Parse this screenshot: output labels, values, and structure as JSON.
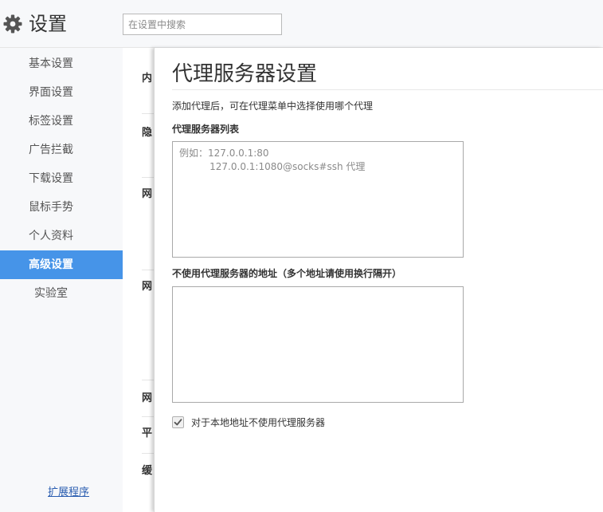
{
  "header": {
    "title": "设置",
    "search_placeholder": "在设置中搜索"
  },
  "sidebar": {
    "items": [
      {
        "label": "基本设置"
      },
      {
        "label": "界面设置"
      },
      {
        "label": "标签设置"
      },
      {
        "label": "广告拦截"
      },
      {
        "label": "下载设置"
      },
      {
        "label": "鼠标手势"
      },
      {
        "label": "个人资料"
      },
      {
        "label": "高级设置",
        "active": true
      },
      {
        "label": "实验室"
      }
    ],
    "extensions_link": "扩展程序"
  },
  "underlying": {
    "labels": [
      "内",
      "隐",
      "网",
      "网",
      "网",
      "平",
      "缓"
    ]
  },
  "proxy_panel": {
    "title": "代理服务器设置",
    "description": "添加代理后，可在代理菜单中选择使用哪个代理",
    "list_label": "代理服务器列表",
    "list_placeholder": "例如：127.0.0.1:80\n          127.0.0.1:1080@socks#ssh 代理",
    "bypass_label": "不使用代理服务器的地址（多个地址请使用换行隔开）",
    "bypass_value": "",
    "local_bypass_label": "对于本地地址不使用代理服务器",
    "local_bypass_checked": true
  },
  "colors": {
    "accent": "#4694e8",
    "sidebar_bg": "#f7f8fa",
    "link": "#2a5db0"
  },
  "icons": {
    "settings": "gear-icon",
    "check": "checkmark-icon"
  }
}
